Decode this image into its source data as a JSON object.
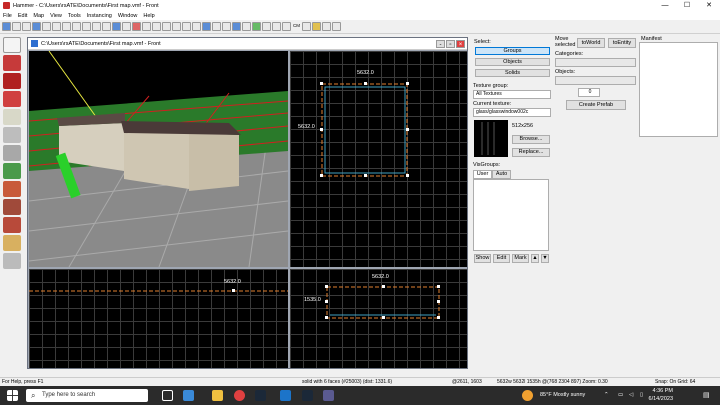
{
  "window": {
    "title": "Hammer - C:\\Users\\rsATE\\Documents\\First map.vmf - Front",
    "min": "—",
    "max": "☐",
    "close": "✕"
  },
  "menu": [
    "File",
    "Edit",
    "Map",
    "View",
    "Tools",
    "Instancing",
    "Window",
    "Help"
  ],
  "toolbar_labels": {
    "cm": "CM"
  },
  "mdi": {
    "title": "C:\\Users\\rsATE\\Documents\\First map.vmf - Front"
  },
  "viewports": {
    "top_right": {
      "label_x": "5632.0",
      "label_y": "5632.0"
    },
    "bottom_left": {
      "label_x": "5632.0"
    },
    "bottom_right": {
      "label_x": "5632.0",
      "label_y": "1535.0"
    }
  },
  "panel": {
    "select_label": "Select:",
    "select_buttons": [
      "Groups",
      "Objects",
      "Solids"
    ],
    "move_selected": "Move selected",
    "to_world": "toWorld",
    "to_entity": "toEntity",
    "categories_label": "Categories:",
    "objects_label": "Objects:",
    "create_prefab": "Create Prefab",
    "stepper_value": "0",
    "manifest_label": "Manifest",
    "texture_group_label": "Texture group:",
    "texture_group_value": "All Textures",
    "current_texture_label": "Current texture:",
    "current_texture_value": "glass/glasswindow002c",
    "texture_size": "512x256",
    "browse": "Browse...",
    "replace": "Replace...",
    "visgroups_label": "VisGroups:",
    "tabs": [
      "User",
      "Auto"
    ],
    "bottom_buttons": [
      "Show",
      "Edit",
      "Mark"
    ]
  },
  "status": {
    "help": "For Help, press F1",
    "solid": "solid with 6 faces (#25003)  (dist: 1331.6)",
    "coords": "@2611, 1603",
    "dims": "5632w 5632l 1535h @(768 2304 897)  Zoom: 0.30",
    "snap": "Snap: On Grid: 64"
  },
  "taskbar": {
    "search_placeholder": "Type here to search",
    "weather": "85°F  Mostly sunny",
    "time": "4:36 PM",
    "date": "6/14/2023"
  }
}
